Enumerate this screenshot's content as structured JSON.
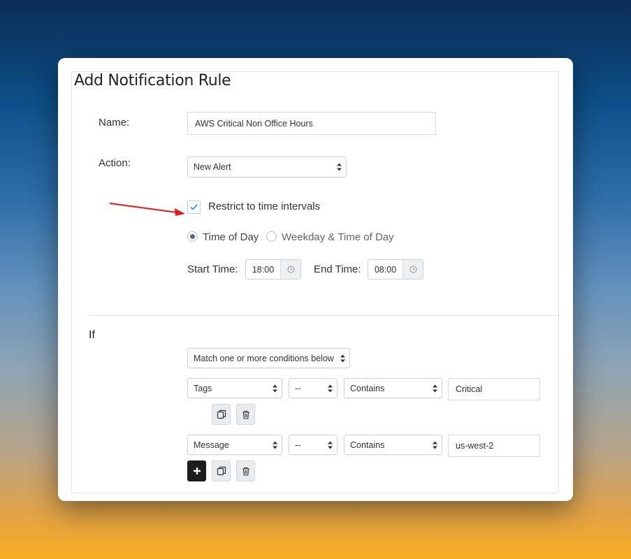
{
  "form": {
    "title": "Add Notification Rule",
    "name_label": "Name:",
    "name_value": "AWS Critical Non Office Hours",
    "action_label": "Action:",
    "action_value": "New Alert",
    "restrict_label": "Restrict to time intervals",
    "restrict_checked": true,
    "time_mode_options": [
      "Time of Day",
      "Weekday & Time of Day"
    ],
    "time_mode_selected": "Time of Day",
    "start_label": "Start Time:",
    "start_value": "18:00",
    "end_label": "End Time:",
    "end_value": "08:00"
  },
  "conditions": {
    "heading": "If",
    "match_value": "Match one or more conditions below",
    "rows": [
      {
        "field": "Tags",
        "operator": "--",
        "comparator": "Contains",
        "value": "Critical"
      },
      {
        "field": "Message",
        "operator": "--",
        "comparator": "Contains",
        "value": "us-west-2"
      }
    ]
  },
  "colors": {
    "annotation_arrow": "#e3191b",
    "check": "#2a9fd6",
    "add_button": "#1d1d1d"
  }
}
